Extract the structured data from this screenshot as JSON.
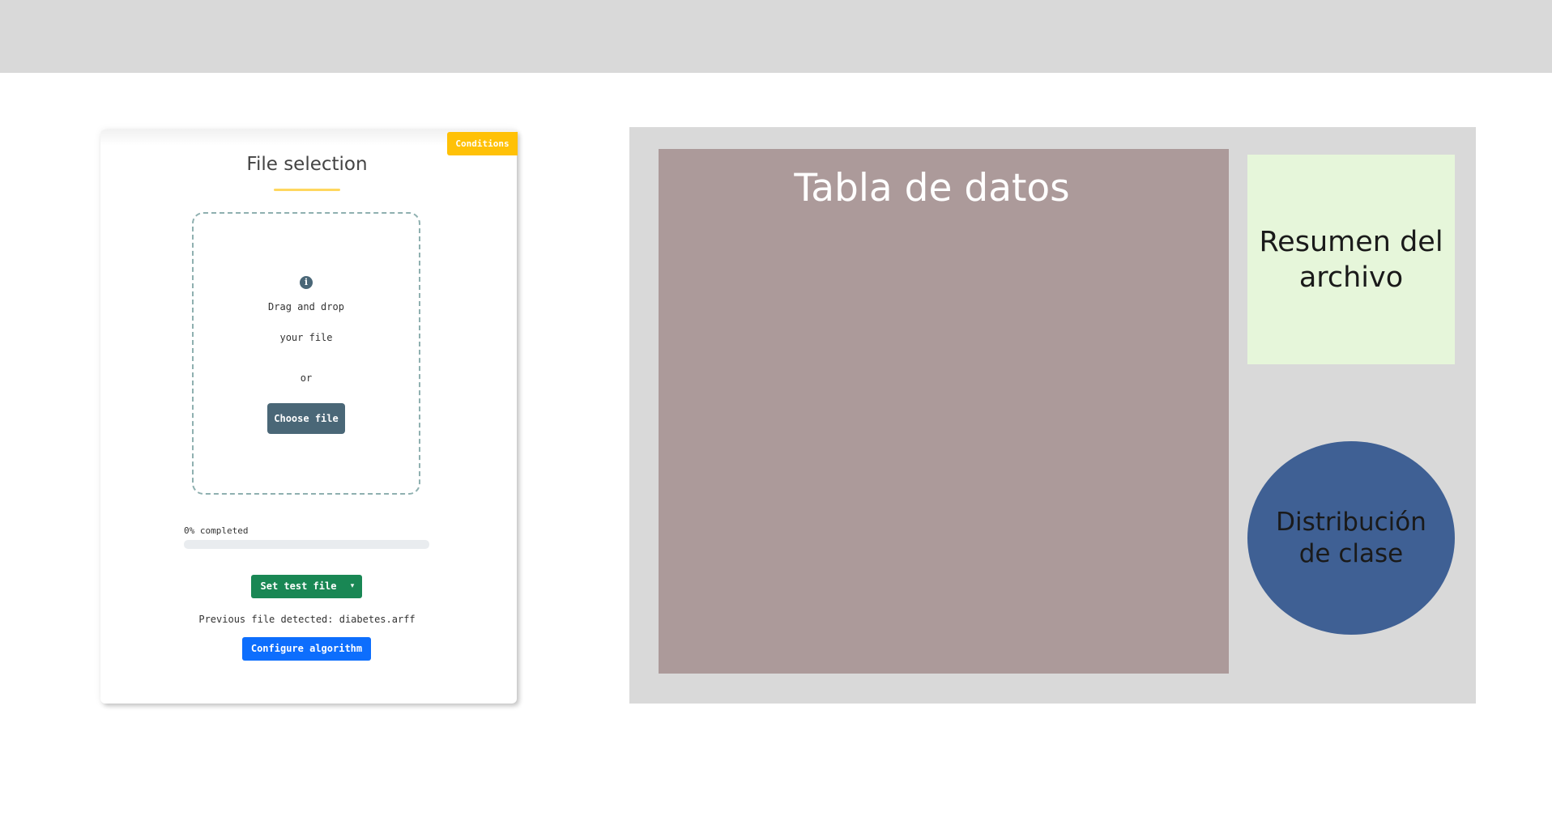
{
  "file_card": {
    "conditions_label": "Conditions",
    "title": "File selection",
    "dropzone": {
      "info_glyph": "i",
      "line1": "Drag and drop",
      "line2": "your file",
      "or_text": "or",
      "choose_label": "Choose file"
    },
    "progress": {
      "label": "0% completed",
      "percent": 0
    },
    "set_test_label": "Set test file",
    "set_test_caret": "▾",
    "previous_file_text": "Previous file detected: diabetes.arff",
    "configure_label": "Configure algorithm"
  },
  "wireframe": {
    "tabla_label": "Tabla de datos",
    "resumen_label": "Resumen del archivo",
    "distribucion_label": "Distribución de clase"
  },
  "colors": {
    "topbar": "#d9d9d9",
    "conditions": "#ffc107",
    "choose_button": "#4a6777",
    "set_test_button": "#198754",
    "configure_button": "#0d6efd",
    "panel_background": "#d9d9d9",
    "tabla": "#ac9a9a",
    "resumen": "#e6f6da",
    "distribucion": "#3f6094"
  },
  "icons": {
    "info": "info-icon",
    "caret": "caret-down-icon"
  }
}
